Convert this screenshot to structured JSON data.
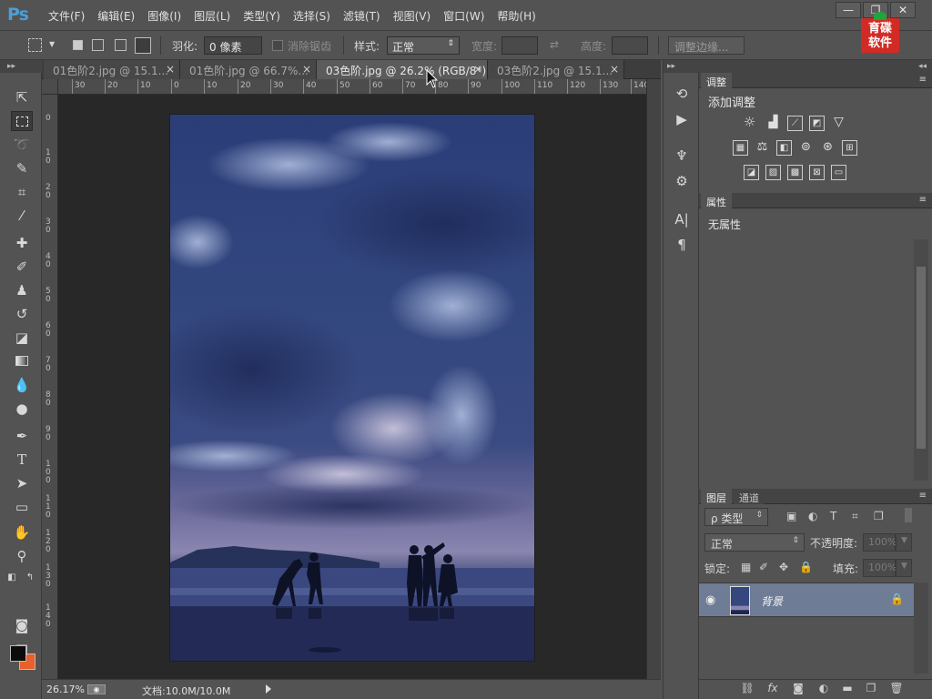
{
  "app": {
    "logo": "Ps",
    "menus": [
      "文件(F)",
      "编辑(E)",
      "图像(I)",
      "图层(L)",
      "类型(Y)",
      "选择(S)",
      "滤镜(T)",
      "视图(V)",
      "窗口(W)",
      "帮助(H)"
    ],
    "window_controls": [
      "—",
      "❐",
      "✕"
    ],
    "badge_text": "育碟软件"
  },
  "options": {
    "feather_label": "羽化:",
    "feather_value": "0 像素",
    "antialias_label": "消除锯齿",
    "style_label": "样式:",
    "style_value": "正常",
    "width_label": "宽度:",
    "height_label": "高度:",
    "refine_edge": "调整边缘..."
  },
  "tabs": [
    {
      "label": "01色阶2.jpg @ 15.1...",
      "active": false
    },
    {
      "label": "01色阶.jpg @ 66.7%...",
      "active": false
    },
    {
      "label": "03色阶.jpg @ 26.2% (RGB/8*)",
      "active": true
    },
    {
      "label": "03色阶2.jpg @ 15.1...",
      "active": false
    }
  ],
  "ruler_h": [
    "30",
    "20",
    "10",
    "0",
    "10",
    "20",
    "30",
    "40",
    "50",
    "60",
    "70",
    "80",
    "90",
    "100",
    "110",
    "120",
    "130",
    "140"
  ],
  "ruler_v": [
    "0",
    "10",
    "20",
    "30",
    "40",
    "50",
    "60",
    "70",
    "80",
    "90",
    "100",
    "110",
    "120",
    "130",
    "140"
  ],
  "status": {
    "zoom": "26.17%",
    "doc": "文档:10.0M/10.0M"
  },
  "panels": {
    "adjustments_title": "调整",
    "add_adjustment": "添加调整",
    "properties_title": "属性",
    "no_properties": "无属性",
    "layers_tab": "图层",
    "channels_tab": "通道",
    "filter_kind": "ρ 类型",
    "blend_mode": "正常",
    "opacity_label": "不透明度:",
    "opacity_value": "100%",
    "lock_label": "锁定:",
    "fill_label": "填充:",
    "fill_value": "100%",
    "layer_name": "背景"
  },
  "colors": {
    "foreground": "#0b0b0b",
    "background": "#e8602c",
    "selected_layer": "#6f7c95",
    "accent_logo": "#4d9dd8"
  }
}
